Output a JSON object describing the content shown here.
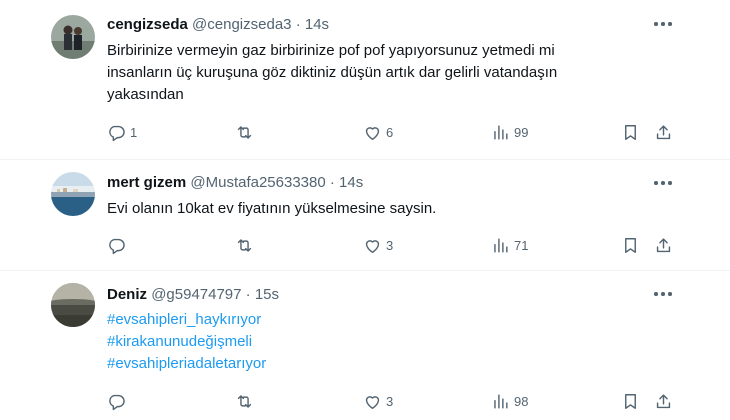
{
  "tweets": [
    {
      "name": "cengizseda",
      "handle": "@cengizseda3",
      "separator": "·",
      "time": "14s",
      "text_lines": [
        "Birbirinize vermeyin gaz birbirinize pof pof yapıyorsunuz yetmedi mi",
        "insanların üç kuruşuna göz diktiniz düşün artık dar gelirli vatandaşın",
        "yakasından"
      ],
      "hashtags": [],
      "replies": "1",
      "retweets": "",
      "likes": "6",
      "views": "99"
    },
    {
      "name": "mert gizem",
      "handle": "@Mustafa25633380",
      "separator": "·",
      "time": "14s",
      "text_lines": [
        "Evi olanın 10kat ev fiyatının yükselmesine saysin."
      ],
      "hashtags": [],
      "replies": "",
      "retweets": "",
      "likes": "3",
      "views": "71"
    },
    {
      "name": "Deniz",
      "handle": "@g59474797",
      "separator": "·",
      "time": "15s",
      "text_lines": [],
      "hashtags": [
        "#evsahipleri_haykırıyor",
        "#kirakanunudeğişmeli",
        "#evsahipleriadaletarıyor"
      ],
      "replies": "",
      "retweets": "",
      "likes": "3",
      "views": "98"
    }
  ],
  "colors": {
    "text": "#0f1419",
    "secondary": "#536471",
    "link": "#1d9bf0",
    "divider": "#eff3f4"
  },
  "icons": [
    "more-icon",
    "reply-icon",
    "retweet-icon",
    "like-icon",
    "views-icon",
    "bookmark-icon",
    "share-icon"
  ]
}
